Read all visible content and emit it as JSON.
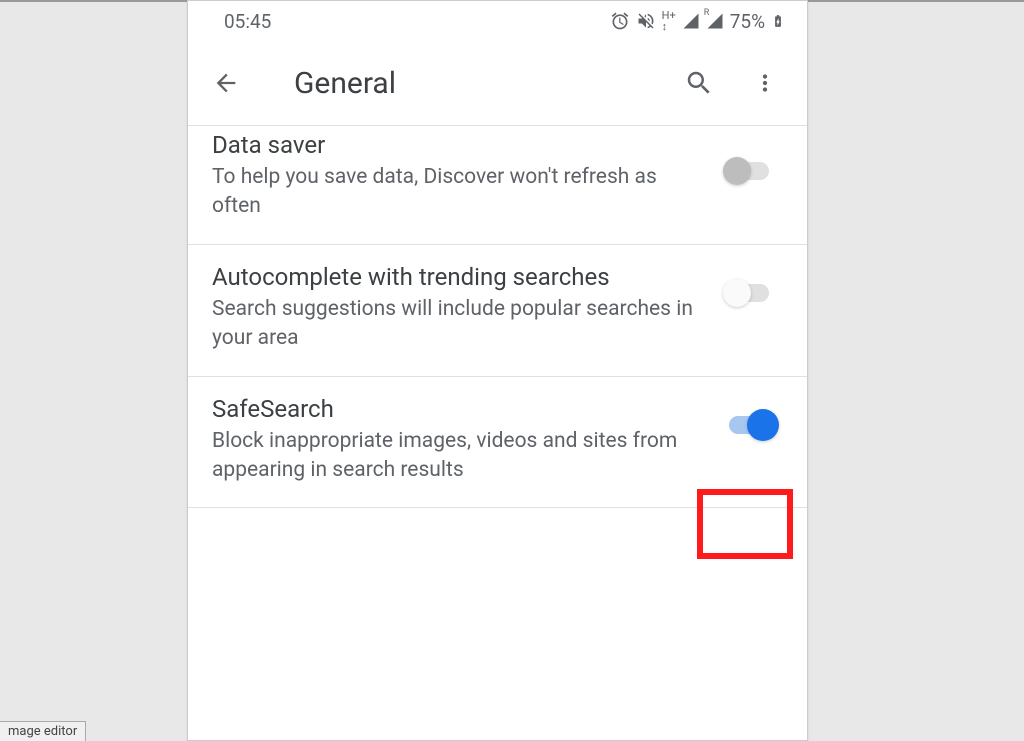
{
  "status_bar": {
    "time": "05:45",
    "battery": "75%"
  },
  "app_bar": {
    "title": "General"
  },
  "settings": [
    {
      "title": "Data saver",
      "description": "To help you save data, Discover won't refresh as often",
      "enabled": false
    },
    {
      "title": "Autocomplete with trending searches",
      "description": "Search suggestions will include popular searches in your area",
      "enabled": false
    },
    {
      "title": "SafeSearch",
      "description": "Block inappropriate images, videos and sites from appearing in search results",
      "enabled": true
    }
  ],
  "editor_tab": "mage editor"
}
